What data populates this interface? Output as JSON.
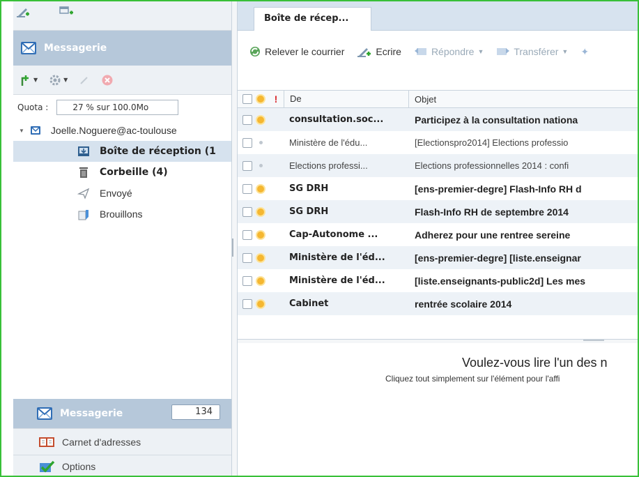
{
  "left": {
    "app_title": "Messagerie",
    "quota": {
      "label": "Quota :",
      "value": "27 % sur 100.0Mo"
    },
    "account": "Joelle.Noguere@ac-toulouse",
    "folders": [
      {
        "label": "Boîte de réception (1",
        "bold": true,
        "icon": "inbox-icon"
      },
      {
        "label": "Corbeille (4)",
        "bold": true,
        "icon": "trash-icon"
      },
      {
        "label": "Envoyé",
        "bold": false,
        "icon": "sent-icon"
      },
      {
        "label": "Brouillons",
        "bold": false,
        "icon": "drafts-icon"
      }
    ],
    "bottom_nav": {
      "active_label": "Messagerie",
      "active_count": "134",
      "items": [
        "Carnet d'adresses",
        "Options"
      ]
    }
  },
  "right": {
    "tab_label": "Boîte de récep...",
    "toolbar": {
      "fetch": "Relever le courrier",
      "compose": "Ecrire",
      "reply": "Répondre",
      "forward": "Transférer"
    },
    "columns": {
      "from": "De",
      "subject": "Objet"
    },
    "messages": [
      {
        "from": "consultation.soc...",
        "subject": "Participez à la consultation nationa",
        "unread": true
      },
      {
        "from": "Ministère de l'édu...",
        "subject": "[Electionspro2014] Elections professio",
        "unread": false
      },
      {
        "from": "Elections professi...",
        "subject": "Elections professionnelles 2014 : confi",
        "unread": false
      },
      {
        "from": "SG DRH",
        "subject": "[ens-premier-degre] Flash-Info RH d",
        "unread": true
      },
      {
        "from": "SG DRH",
        "subject": "Flash-Info RH de septembre 2014",
        "unread": true
      },
      {
        "from": "Cap-Autonome ...",
        "subject": "Adherez pour une rentree sereine",
        "unread": true
      },
      {
        "from": "Ministère de l'éd...",
        "subject": "[ens-premier-degre] [liste.enseignar",
        "unread": true
      },
      {
        "from": "Ministère de l'éd...",
        "subject": "[liste.enseignants-public2d] Les mes",
        "unread": true
      },
      {
        "from": "Cabinet",
        "subject": "rentrée scolaire 2014",
        "unread": true
      }
    ],
    "preview": {
      "heading": "Voulez-vous lire l'un des n",
      "sub": "Cliquez tout simplement sur l'élément pour l'affi"
    }
  },
  "colors": {
    "frame": "#38c038",
    "header": "#b6c8da",
    "unread_sun": "#f5b731",
    "flag": "#d9262b"
  }
}
